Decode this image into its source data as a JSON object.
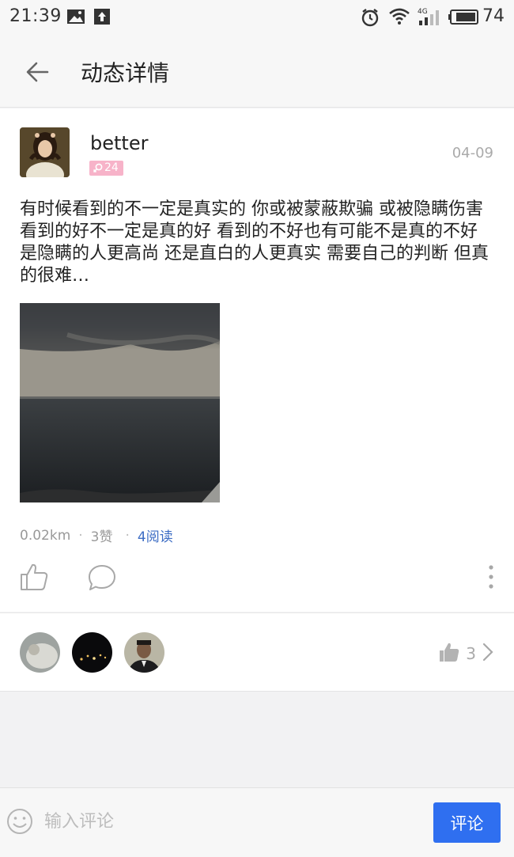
{
  "status_bar": {
    "time": "21:39",
    "battery": "74",
    "network": "4G"
  },
  "header": {
    "title": "动态详情"
  },
  "post": {
    "username": "better",
    "badge_count": "24",
    "date": "04-09",
    "content": "有时候看到的不一定是真实的 你或被蒙蔽欺骗 或被隐瞒伤害 看到的好不一定是真的好 看到的不好也有可能不是真的不好 是隐瞒的人更高尚 还是直白的人更真实 需要自己的判断 但真的很难…",
    "distance": "0.02km",
    "likes_text": "3赞",
    "reads_text": "4阅读"
  },
  "likers": {
    "count": "3"
  },
  "comment_bar": {
    "placeholder": "输入评论",
    "submit_label": "评论"
  },
  "colors": {
    "accent": "#2f6ff0",
    "link": "#3d6dc4",
    "badge": "#f7b3c9"
  }
}
